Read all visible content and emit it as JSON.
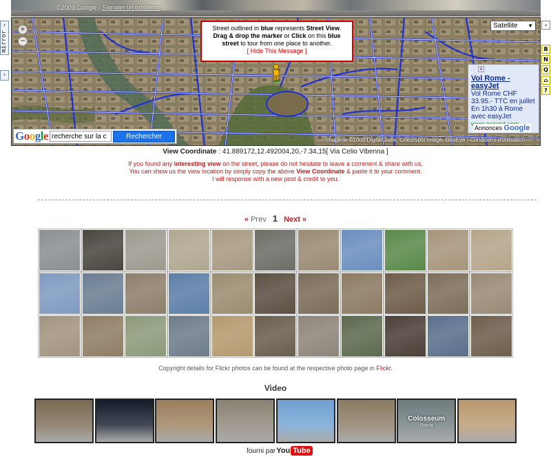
{
  "left_tab": {
    "label": "mirror"
  },
  "right_tools": [
    "B",
    "N",
    "Q",
    "⌂",
    "?"
  ],
  "streetview": {
    "copyright": "©2009 Google",
    "links": "Signaler un problème"
  },
  "map": {
    "zoom_in": "+",
    "zoom_out": "−",
    "map_type": "Satellite",
    "info": {
      "l1a": "Street outlined in ",
      "l1b": "blue",
      "l1c": " represents ",
      "l1d": "Street View",
      "l2a": "Drag & drop the marker",
      "l2b": " or ",
      "l2c": "Click",
      "l2d": " on this ",
      "l2e": "blue",
      "l3a": "street",
      "l3b": " to tour from one place to another.",
      "hide": "[ Hide This Message ]"
    },
    "ad": {
      "close": "x",
      "title": "Vol Rome - easyJet",
      "text": "Vol Rome CHF 33.95.- TTC en juillet En 1h30 à Rome avec easyJet",
      "url": "www.easyjet.com"
    },
    "annonces": "Annonces",
    "annonces_brand": "Google",
    "copyright": "Imagerie ©2009 DigitalGlobe, Cnes/Spot Image, GeoEye - Conditions d'utilisation",
    "search_logo": "Google",
    "search_value": "recherche sur la c",
    "search_button": "Rechercher"
  },
  "coords": {
    "label": "View Coordinate",
    "value": " : 41.889172,12.492004,20,-7.34,15[ Via Celio Vibenna ]"
  },
  "notes": {
    "l1a": "If you found any ",
    "l1b": "interesting view",
    "l1c": " on the street, please do not hesitate to leave a comment & share with us.",
    "l2a": "You can show us the view location by simply copy the above ",
    "l2b": "View Coordinate",
    "l2c": " & paste it to your comment.",
    "l3": "I will response with a new post & credit to you."
  },
  "pager": {
    "prev_arrow": "«",
    "prev": "Prev",
    "current": "1",
    "next": "Next",
    "next_arrow": "»"
  },
  "credit": {
    "text": "Copyright details for Flickr photos can be found at the respective photo page in ",
    "link": "Flickr",
    "end": "."
  },
  "video": {
    "title": "Video",
    "thumb_label": "Colosseum",
    "thumb_sub": "Roma",
    "provided_by": "fourni par",
    "yt_you": "You",
    "yt_tube": "Tube"
  },
  "palette": {
    "photos": [
      [
        "#8a8f92",
        "#4a4640",
        "#9d9a8f",
        "#b0a790",
        "#a89a82",
        "#6e6d66",
        "#9a8a72",
        "#6b8fbf",
        "#5a8a4a",
        "#a7957b",
        "#b5a58a"
      ],
      [
        "#7f9ac0",
        "#6a7e92",
        "#8d7f6b",
        "#5c7ea8",
        "#9a8d70",
        "#5b5043",
        "#7b6c58",
        "#8c7a62",
        "#6e5c48",
        "#7e6e5a",
        "#9a8a76"
      ],
      [
        "#a39480",
        "#8f7d66",
        "#8d9a7a",
        "#6e7c8a",
        "#b59a6e",
        "#6a5e4e",
        "#8e857a",
        "#5c6a4e",
        "#4c4038",
        "#5a6f8c",
        "#6e5e4c"
      ]
    ],
    "videos": [
      "#7a6a52",
      "#151c2a",
      "#9a7e5c",
      "#8a8274",
      "#6fa0d0",
      "#8a7a62",
      "#6e7c7e",
      "#b8986e"
    ]
  }
}
